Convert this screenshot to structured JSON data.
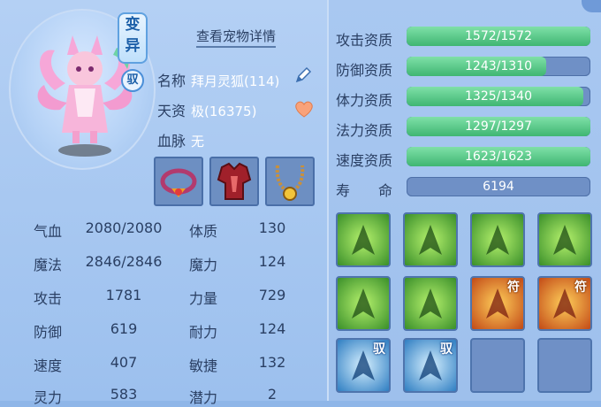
{
  "pet": {
    "badge_bian": "变异",
    "badge_yu": "驭",
    "detail_link": "查看宠物详情",
    "name_label": "名称",
    "name_value": "拜月灵狐(114)",
    "aptitude_label": "天资",
    "aptitude_value": "极(16375)",
    "bloodline_label": "血脉",
    "bloodline_value": "无"
  },
  "equipment": [
    {
      "name": "collar-equipment"
    },
    {
      "name": "armor-equipment"
    },
    {
      "name": "amulet-equipment"
    }
  ],
  "stats_left": [
    {
      "label": "气血",
      "value": "2080/2080"
    },
    {
      "label": "魔法",
      "value": "2846/2846"
    },
    {
      "label": "攻击",
      "value": "1781"
    },
    {
      "label": "防御",
      "value": "619"
    },
    {
      "label": "速度",
      "value": "407"
    },
    {
      "label": "灵力",
      "value": "583"
    }
  ],
  "stats_right": [
    {
      "label": "体质",
      "value": "130"
    },
    {
      "label": "魔力",
      "value": "124"
    },
    {
      "label": "力量",
      "value": "729"
    },
    {
      "label": "耐力",
      "value": "124"
    },
    {
      "label": "敏捷",
      "value": "132"
    },
    {
      "label": "潜力",
      "value": "2"
    }
  ],
  "aptitudes": [
    {
      "label": "攻击资质",
      "text": "1572/1572",
      "fill": 1.0
    },
    {
      "label": "防御资质",
      "text": "1243/1310",
      "fill": 0.76
    },
    {
      "label": "体力资质",
      "text": "1325/1340",
      "fill": 0.96
    },
    {
      "label": "法力资质",
      "text": "1297/1297",
      "fill": 1.0
    },
    {
      "label": "速度资质",
      "text": "1623/1623",
      "fill": 1.0
    }
  ],
  "lifespan": {
    "label": "寿　　命",
    "value": "6194"
  },
  "skills": [
    {
      "style": "green",
      "tag": "",
      "icon": "sword-skill-icon"
    },
    {
      "style": "green",
      "tag": "",
      "icon": "demon-strength-skill-icon"
    },
    {
      "style": "green",
      "tag": "",
      "icon": "agility-skill-icon"
    },
    {
      "style": "green",
      "tag": "",
      "icon": "night-combat-skill-icon"
    },
    {
      "style": "green",
      "tag": "",
      "icon": "shield-skill-icon"
    },
    {
      "style": "green",
      "tag": "",
      "icon": "power-skill-icon"
    },
    {
      "style": "red",
      "tag": "符",
      "icon": "bleed-talisman-skill-icon"
    },
    {
      "style": "red",
      "tag": "符",
      "icon": "blade-talisman-skill-icon"
    },
    {
      "style": "blue",
      "tag": "驭",
      "icon": "water-blade-skill-icon"
    },
    {
      "style": "blue",
      "tag": "驭",
      "icon": "water-sword-skill-icon"
    },
    {
      "style": "empty",
      "tag": "",
      "icon": ""
    },
    {
      "style": "empty",
      "tag": "",
      "icon": ""
    }
  ]
}
